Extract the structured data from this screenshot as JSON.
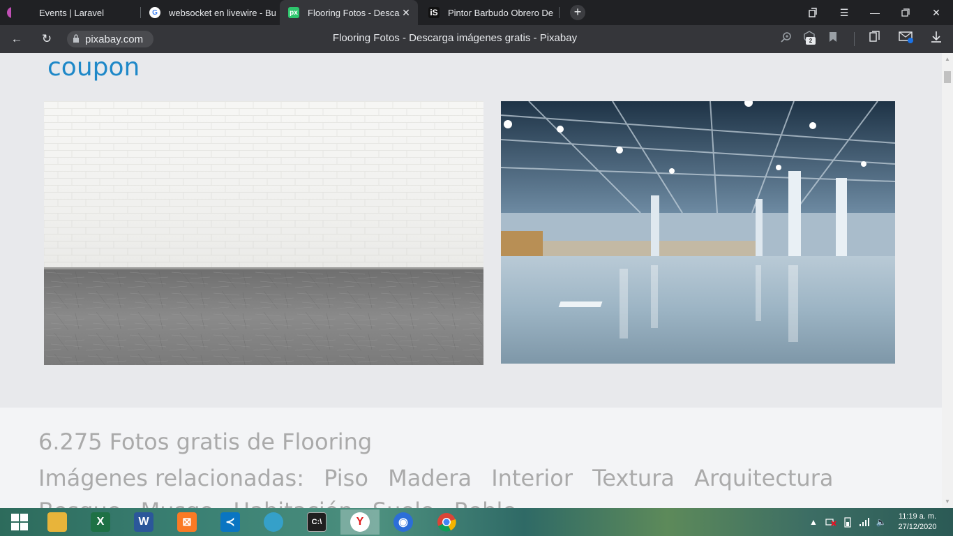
{
  "browser": {
    "tabs": [
      {
        "title": "Events | Laravel",
        "icon": "laravel-icon",
        "active": false
      },
      {
        "title": "websocket en livewire - Bu",
        "icon": "google-icon",
        "active": false
      },
      {
        "title": "Flooring Fotos - Descarg",
        "icon": "pixabay-icon",
        "active": true
      },
      {
        "title": "Pintor Barbudo Obrero De",
        "icon": "istock-icon",
        "active": false
      }
    ],
    "url_host": "pixabay.com",
    "page_title": "Flooring Fotos - Descarga imágenes gratis - Pixabay",
    "notification_badge": "2"
  },
  "page": {
    "coupon_text": "coupon",
    "results_count": "6.275 Fotos gratis de Flooring",
    "related_label": "Imágenes relacionadas:",
    "related_tags": [
      "Piso",
      "Madera",
      "Interior",
      "Textura",
      "Arquitectura",
      "Bosque",
      "Musgo",
      "Habitación",
      "Suelo",
      "Roble"
    ],
    "photos": [
      {
        "subject": "white brick wall with concrete floor"
      },
      {
        "subject": "empty warehouse interior with glossy floor"
      }
    ]
  },
  "taskbar": {
    "apps": [
      "windows-start",
      "file-explorer",
      "excel",
      "word",
      "xampp",
      "vscode",
      "postgres",
      "terminal",
      "yandex",
      "firefox",
      "chrome"
    ],
    "active_app": "yandex",
    "clock_time": "11:19 a. m.",
    "clock_date": "27/12/2020"
  }
}
